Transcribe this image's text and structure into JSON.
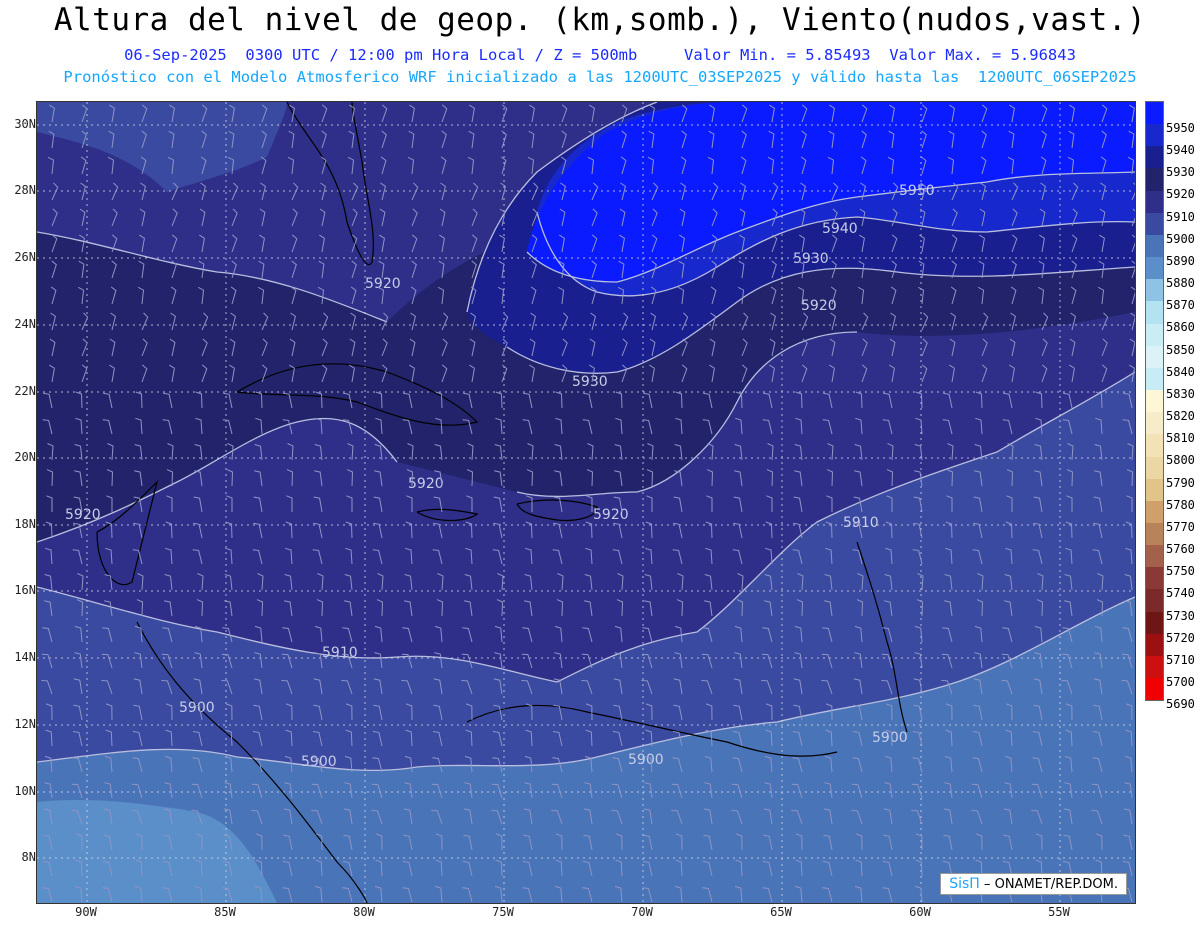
{
  "title": "Altura del nivel de geop. (km,somb.), Viento(nudos,vast.)",
  "subtitle_1": "06-Sep-2025  0300 UTC / 12:00 pm Hora Local / Z = 500mb     Valor Min. = 5.85493  Valor Max. = 5.96843",
  "subtitle_2": "Pronóstico con el Modelo Atmosferico WRF inicializado a las 1200UTC_03SEP2025 y válido hasta las  1200UTC_06SEP2025",
  "lat_labels": [
    "30N",
    "28N",
    "26N",
    "24N",
    "22N",
    "20N",
    "18N",
    "16N",
    "14N",
    "12N",
    "10N",
    "8N"
  ],
  "lon_labels": [
    "90W",
    "85W",
    "80W",
    "75W",
    "70W",
    "65W",
    "60W",
    "55W"
  ],
  "colorbar": {
    "levels": [
      "5950",
      "5940",
      "5930",
      "5920",
      "5910",
      "5900",
      "5890",
      "5880",
      "5870",
      "5860",
      "5850",
      "5840",
      "5830",
      "5820",
      "5810",
      "5800",
      "5790",
      "5780",
      "5770",
      "5760",
      "5750",
      "5740",
      "5730",
      "5720",
      "5710",
      "5700",
      "5690"
    ],
    "colors": [
      "#0a1cff",
      "#1728cc",
      "#1a1f8f",
      "#22236b",
      "#2f2f8a",
      "#3a4aa0",
      "#4a74b8",
      "#5b8fc9",
      "#8fc3e6",
      "#b3e3f0",
      "#c9ecf5",
      "#dcf1f8",
      "#c7ecf6",
      "#fff6d8",
      "#f7ecc9",
      "#f2e2b6",
      "#ead7a3",
      "#e0c48a",
      "#cfa06a",
      "#b9835a",
      "#a3604a",
      "#8a3a36",
      "#7a2a2a",
      "#6e1616",
      "#9b1010",
      "#cc1010",
      "#f00000"
    ]
  },
  "contour_labels": [
    "5950",
    "5940",
    "5930",
    "5920",
    "5920",
    "5930",
    "5920",
    "5920",
    "5920",
    "5910",
    "5910",
    "5900",
    "5900",
    "5900",
    "5900"
  ],
  "credit": {
    "sis": "SisΠ",
    "org": "– ONAMET/REP.DOM."
  },
  "colors": {
    "title": "#000000",
    "subtitle_1": "#1b2bff",
    "subtitle_2": "#16a6ff"
  }
}
